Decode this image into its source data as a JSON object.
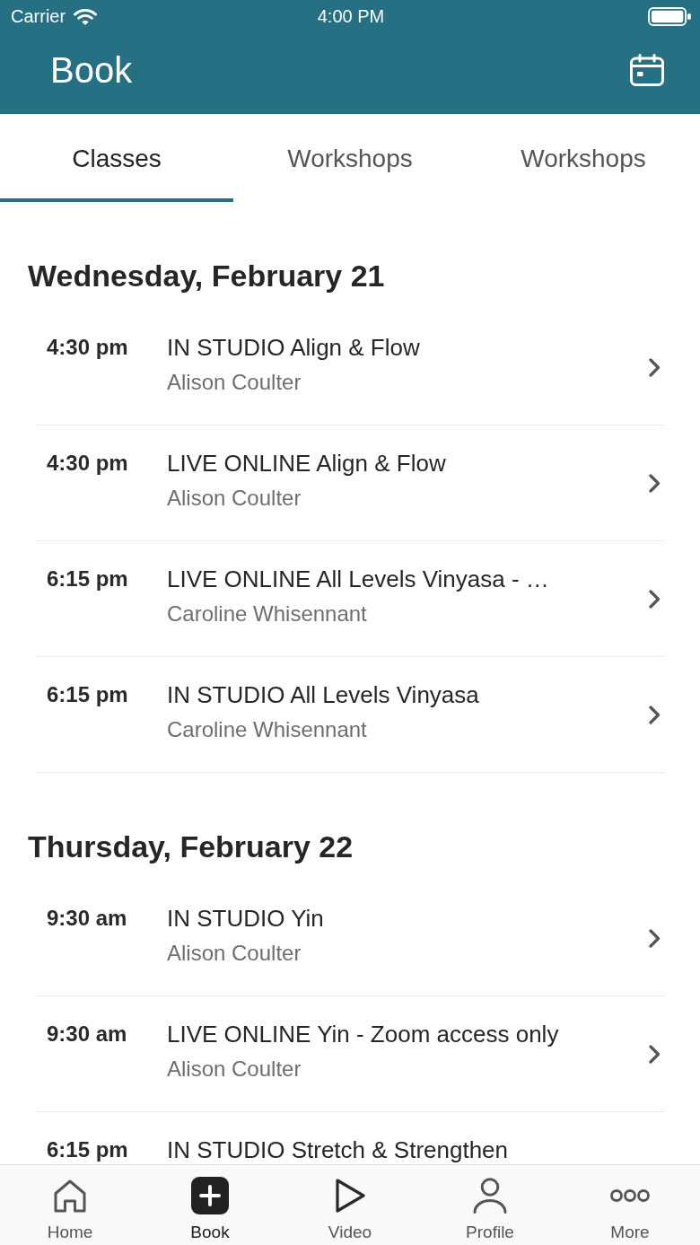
{
  "status_bar": {
    "carrier": "Carrier",
    "time": "4:00 PM"
  },
  "header": {
    "title": "Book"
  },
  "tabs": [
    {
      "label": "Classes",
      "selected": true
    },
    {
      "label": "Workshops",
      "selected": false
    },
    {
      "label": "Workshops",
      "selected": false
    }
  ],
  "days": [
    {
      "heading": "Wednesday, February 21",
      "classes": [
        {
          "time": "4:30 pm",
          "title": "IN STUDIO Align & Flow",
          "instructor": "Alison Coulter"
        },
        {
          "time": "4:30 pm",
          "title": "LIVE ONLINE Align & Flow",
          "instructor": "Alison Coulter"
        },
        {
          "time": "6:15 pm",
          "title": "LIVE ONLINE All Levels Vinyasa - …",
          "instructor": "Caroline Whisennant"
        },
        {
          "time": "6:15 pm",
          "title": "IN STUDIO All Levels Vinyasa",
          "instructor": "Caroline Whisennant"
        }
      ]
    },
    {
      "heading": "Thursday, February 22",
      "classes": [
        {
          "time": "9:30 am",
          "title": "IN STUDIO Yin",
          "instructor": "Alison Coulter"
        },
        {
          "time": "9:30 am",
          "title": "LIVE ONLINE Yin - Zoom access only",
          "instructor": "Alison Coulter"
        },
        {
          "time": "6:15 pm",
          "title": "IN STUDIO Stretch & Strengthen"
        }
      ]
    }
  ],
  "tab_bar": [
    {
      "label": "Home",
      "kind": "home",
      "selected": false
    },
    {
      "label": "Book",
      "kind": "book",
      "selected": true
    },
    {
      "label": "Video",
      "kind": "video",
      "selected": false
    },
    {
      "label": "Profile",
      "kind": "profile",
      "selected": false
    },
    {
      "label": "More",
      "kind": "more",
      "selected": false
    }
  ]
}
